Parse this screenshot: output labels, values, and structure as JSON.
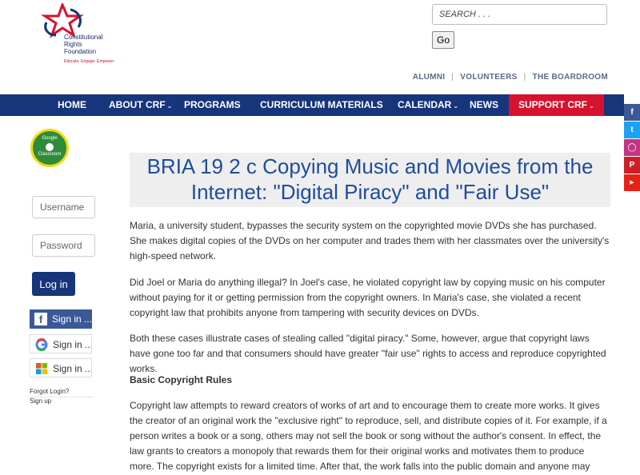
{
  "header": {
    "logo_lines": [
      "Constitutional",
      "Rights",
      "Foundation"
    ],
    "tagline": "Educate. Engage. Empower.",
    "search_placeholder": "SEARCH . . .",
    "go_label": "Go",
    "toplinks": [
      "ALUMNI",
      "VOLUNTEERS",
      "THE BOARDROOM"
    ]
  },
  "nav": {
    "items": [
      "HOME",
      "ABOUT CRF",
      "PROGRAMS",
      "CURRICULUM MATERIALS",
      "CALENDAR",
      "NEWS",
      "SUPPORT CRF"
    ],
    "colors": {
      "bar": "#16357a",
      "support": "#d6122e"
    }
  },
  "social": [
    "facebook-icon",
    "twitter-icon",
    "instagram-icon",
    "pinterest-icon",
    "youtube-icon"
  ],
  "sidebar": {
    "gclass_line1": "Google",
    "gclass_line2": "Classroom",
    "username_placeholder": "Username",
    "password_placeholder": "Password",
    "login_label": "Log in",
    "signin_facebook": "Sign in ...",
    "signin_google": "Sign in ...",
    "signin_microsoft": "Sign in ...",
    "forgot": "Forgot Login?",
    "signup": "Sign up"
  },
  "article": {
    "title": "BRIA 19 2 c Copying Music and Movies from the Internet: \"Digital Piracy\" and \"Fair Use\"",
    "p1": "Maria, a university student, bypasses the security system on the copyrighted movie DVDs she has purchased. She makes digital copies of the DVDs on her computer and trades them with her classmates over the university's high-speed network.",
    "p2": "Did Joel or Maria do anything illegal? In Joel's case, he violated copyright law by copying music on his computer without paying for it or getting permission from the copyright owners. In Maria's case, she violated a recent copyright law that prohibits anyone from tampering with security devices on DVDs.",
    "p3": "Both these cases illustrate cases of stealing called \"digital piracy.\" Some, however, argue that copyright laws have gone too far and that consumers should have greater \"fair use\" rights to access and reproduce copyrighted works.",
    "subhead": "Basic Copyright Rules",
    "p4": "Copyright law attempts to reward creators of works of art and to encourage them to create more works. It gives the creator of an original work the \"exclusive right\" to reproduce, sell, and distribute copies of it. For example, if a person writes a book or a song, others may not sell the book or song without the author's consent. In effect, the law grants to creators a monopoly that rewards them for their original works and motivates them to produce more. The copyright exists for a limited time. After that, the work falls into the public domain and anyone may copy it."
  }
}
